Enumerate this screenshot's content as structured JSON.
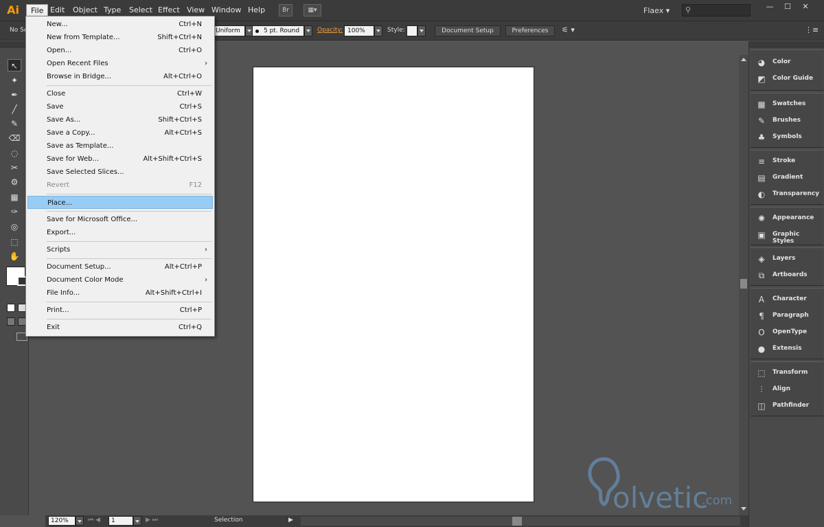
{
  "app": {
    "logo": "Ai",
    "workspace": "Flaex",
    "search_glyph": "⚲",
    "window_controls": [
      "—",
      "☐",
      "✕"
    ]
  },
  "menubar": {
    "items": [
      "File",
      "Edit",
      "Object",
      "Type",
      "Select",
      "Effect",
      "View",
      "Window",
      "Help"
    ],
    "bridge_label": "Br"
  },
  "controlbar": {
    "selection_text": "No Se",
    "stroke_profile": "Uniform",
    "brush": "5 pt. Round",
    "opacity_label": "Opacity:",
    "opacity_value": "100%",
    "style_label": "Style:",
    "document_setup_label": "Document Setup",
    "preferences_label": "Preferences"
  },
  "file_menu": {
    "items": [
      {
        "label": "New...",
        "shortcut": "Ctrl+N"
      },
      {
        "label": "New from Template...",
        "shortcut": "Shift+Ctrl+N"
      },
      {
        "label": "Open...",
        "shortcut": "Ctrl+O"
      },
      {
        "label": "Open Recent Files",
        "shortcut": "›"
      },
      {
        "label": "Browse in Bridge...",
        "shortcut": "Alt+Ctrl+O"
      },
      {
        "label": "Close",
        "shortcut": "Ctrl+W"
      },
      {
        "label": "Save",
        "shortcut": "Ctrl+S"
      },
      {
        "label": "Save As...",
        "shortcut": "Shift+Ctrl+S"
      },
      {
        "label": "Save a Copy...",
        "shortcut": "Alt+Ctrl+S"
      },
      {
        "label": "Save as Template...",
        "shortcut": ""
      },
      {
        "label": "Save for Web...",
        "shortcut": "Alt+Shift+Ctrl+S"
      },
      {
        "label": "Save Selected Slices...",
        "shortcut": ""
      },
      {
        "label": "Revert",
        "shortcut": "F12"
      },
      {
        "label": "Place...",
        "shortcut": ""
      },
      {
        "label": "Save for Microsoft Office...",
        "shortcut": ""
      },
      {
        "label": "Export...",
        "shortcut": ""
      },
      {
        "label": "Scripts",
        "shortcut": "›"
      },
      {
        "label": "Document Setup...",
        "shortcut": "Alt+Ctrl+P"
      },
      {
        "label": "Document Color Mode",
        "shortcut": "›"
      },
      {
        "label": "File Info...",
        "shortcut": "Alt+Shift+Ctrl+I"
      },
      {
        "label": "Print...",
        "shortcut": "Ctrl+P"
      },
      {
        "label": "Exit",
        "shortcut": "Ctrl+Q"
      }
    ]
  },
  "panels": {
    "items": [
      {
        "label": "Color",
        "icon": "palette-icon",
        "glyph": "◕"
      },
      {
        "label": "Color Guide",
        "icon": "color-guide-icon",
        "glyph": "◩"
      },
      {
        "label": "Swatches",
        "icon": "swatches-icon",
        "glyph": "▦"
      },
      {
        "label": "Brushes",
        "icon": "brushes-icon",
        "glyph": "✎"
      },
      {
        "label": "Symbols",
        "icon": "symbols-icon",
        "glyph": "♣"
      },
      {
        "label": "Stroke",
        "icon": "stroke-icon",
        "glyph": "≡"
      },
      {
        "label": "Gradient",
        "icon": "gradient-icon",
        "glyph": "▤"
      },
      {
        "label": "Transparency",
        "icon": "transparency-icon",
        "glyph": "◐"
      },
      {
        "label": "Appearance",
        "icon": "appearance-icon",
        "glyph": "✺"
      },
      {
        "label": "Graphic Styles",
        "icon": "graphic-styles-icon",
        "glyph": "▣"
      },
      {
        "label": "Layers",
        "icon": "layers-icon",
        "glyph": "◈"
      },
      {
        "label": "Artboards",
        "icon": "artboards-icon",
        "glyph": "⧉"
      },
      {
        "label": "Character",
        "icon": "character-icon",
        "glyph": "A"
      },
      {
        "label": "Paragraph",
        "icon": "paragraph-icon",
        "glyph": "¶"
      },
      {
        "label": "OpenType",
        "icon": "opentype-icon",
        "glyph": "O"
      },
      {
        "label": "Extensis",
        "icon": "extensis-icon",
        "glyph": "●"
      },
      {
        "label": "Transform",
        "icon": "transform-icon",
        "glyph": "⬚"
      },
      {
        "label": "Align",
        "icon": "align-icon",
        "glyph": "⫶"
      },
      {
        "label": "Pathfinder",
        "icon": "pathfinder-icon",
        "glyph": "◫"
      }
    ]
  },
  "tools": [
    "↖",
    "✦",
    "✒",
    "╱",
    "✎",
    "⌫",
    "◌",
    "✂",
    "⚙",
    "▦",
    "✑",
    "◎",
    "⬚",
    "✋"
  ],
  "statusbar": {
    "zoom": "120%",
    "artboard": "1",
    "status_text": "Selection"
  },
  "watermark": {
    "text": "olvetic",
    "suffix": ".com"
  },
  "colors": {
    "accent": "#ff9a00",
    "highlight": "#99ccf5",
    "opacity_label": "#f0a040",
    "watermark": "#6fa3d4"
  }
}
